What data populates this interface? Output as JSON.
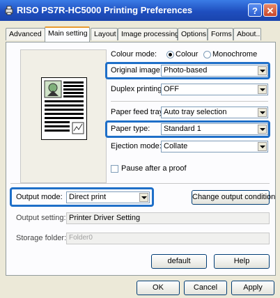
{
  "window": {
    "title": "RISO PS7R-HC5000 Printing Preferences",
    "help_btn": "?",
    "close_btn": "✕"
  },
  "tabs": [
    {
      "label": "Advanced"
    },
    {
      "label": "Main setting"
    },
    {
      "label": "Layout"
    },
    {
      "label": "Image processing"
    },
    {
      "label": "Options"
    },
    {
      "label": "Forms"
    },
    {
      "label": "About.."
    }
  ],
  "colour_mode": {
    "label": "Colour mode:",
    "options": [
      "Colour",
      "Monochrome"
    ],
    "selected": "Colour"
  },
  "original_image": {
    "label": "Original image:",
    "value": "Photo-based"
  },
  "duplex": {
    "label": "Duplex printing:",
    "value": "OFF"
  },
  "paper_feed": {
    "label": "Paper feed tray:",
    "value": "Auto tray selection"
  },
  "paper_type": {
    "label": "Paper type:",
    "value": "Standard 1"
  },
  "ejection": {
    "label": "Ejection mode:",
    "value": "Collate"
  },
  "pause": {
    "label": "Pause after a proof",
    "checked": false
  },
  "output_mode": {
    "label": "Output mode:",
    "value": "Direct print"
  },
  "change_output_btn": "Change output condition",
  "output_setting": {
    "label": "Output setting:",
    "value": "Printer Driver Setting"
  },
  "storage_folder": {
    "label": "Storage folder:",
    "value": "Folder0"
  },
  "default_btn": "default",
  "help_btn": "Help",
  "footer": {
    "ok": "OK",
    "cancel": "Cancel",
    "apply": "Apply"
  },
  "accent": "#1e6fc8"
}
